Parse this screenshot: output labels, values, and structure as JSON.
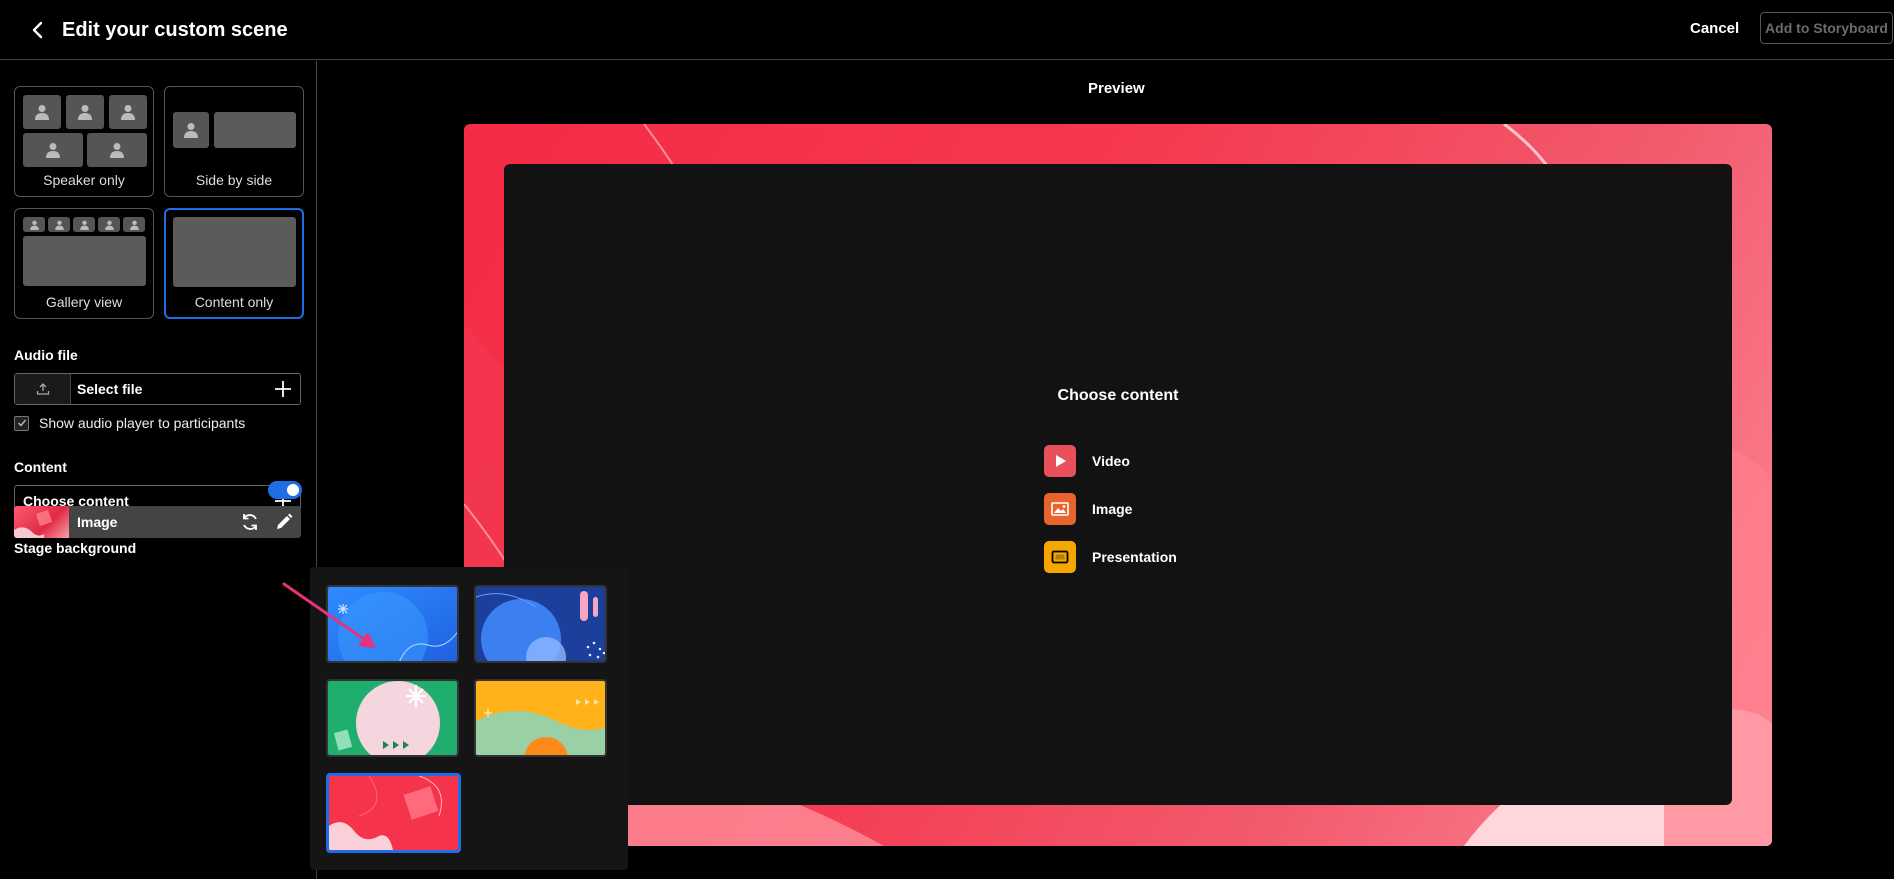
{
  "header": {
    "title": "Edit your custom scene",
    "cancel_label": "Cancel",
    "add_label": "Add to Storyboard"
  },
  "layouts": [
    {
      "label": "Speaker only"
    },
    {
      "label": "Side by side"
    },
    {
      "label": "Gallery view"
    },
    {
      "label": "Content only",
      "selected": true
    }
  ],
  "audio": {
    "section_label": "Audio file",
    "select_label": "Select file",
    "checkbox_label": "Show audio player to participants",
    "checkbox_checked": true
  },
  "content": {
    "section_label": "Content",
    "choose_label": "Choose content"
  },
  "background": {
    "section_label": "Stage background",
    "toggle_on": true,
    "type_label": "Image"
  },
  "preview": {
    "label": "Preview",
    "choose_title": "Choose content",
    "options": [
      {
        "label": "Video",
        "icon": "play-icon",
        "color": "#e8505b"
      },
      {
        "label": "Image",
        "icon": "image-icon",
        "color": "#e8642c"
      },
      {
        "label": "Presentation",
        "icon": "presentation-icon",
        "color": "#f5a700"
      }
    ]
  },
  "background_picker": {
    "thumbnails": [
      {
        "name": "blue-light"
      },
      {
        "name": "blue-dark"
      },
      {
        "name": "green"
      },
      {
        "name": "yellow"
      },
      {
        "name": "red",
        "selected": true
      }
    ]
  },
  "colors": {
    "accent": "#1e6fe6",
    "stage_red": "#f42b44",
    "arrow": "#e8317a"
  }
}
